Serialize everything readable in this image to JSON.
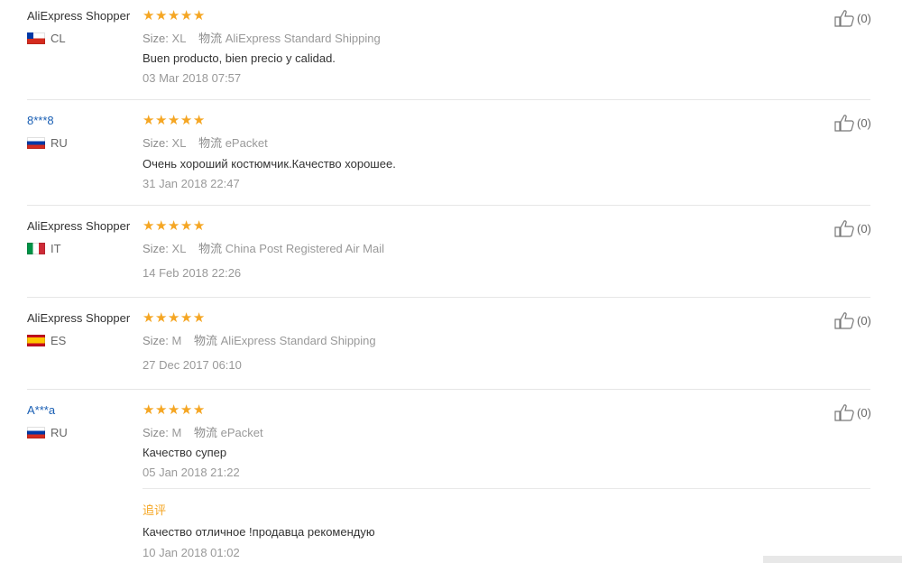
{
  "labels": {
    "size": "Size:",
    "logistics": "物流"
  },
  "reviews": [
    {
      "user": "AliExpress Shopper",
      "country": "CL",
      "size": "XL",
      "shipping": "AliExpress Standard Shipping",
      "comment": "Buen producto, bien precio y calidad.",
      "date": "03 Mar 2018 07:57",
      "helpful": "(0)",
      "rating": 5
    },
    {
      "user": "8***8",
      "country": "RU",
      "size": "XL",
      "shipping": "ePacket",
      "comment": "Очень хороший костюмчик.Качество хорошее.",
      "date": "31 Jan 2018 22:47",
      "helpful": "(0)",
      "rating": 5
    },
    {
      "user": "AliExpress Shopper",
      "country": "IT",
      "size": "XL",
      "shipping": "China Post Registered Air Mail",
      "comment": "",
      "date": "14 Feb 2018 22:26",
      "helpful": "(0)",
      "rating": 5
    },
    {
      "user": "AliExpress Shopper",
      "country": "ES",
      "size": "M",
      "shipping": "AliExpress Standard Shipping",
      "comment": "",
      "date": "27 Dec 2017 06:10",
      "helpful": "(0)",
      "rating": 5
    },
    {
      "user": "A***a",
      "country": "RU",
      "size": "M",
      "shipping": "ePacket",
      "comment": "Качество супер",
      "date": "05 Jan 2018 21:22",
      "helpful": "(0)",
      "rating": 5,
      "followup": {
        "label": "追评",
        "comment": "Качество отличное !продавца рекомендую",
        "date": "10 Jan 2018 01:02"
      }
    }
  ],
  "colors": {
    "star": "#f5a623",
    "link": "#1a5fb4",
    "muted": "#999999"
  },
  "icons": {
    "star": "star-icon",
    "helpful": "thumbs-up-icon"
  }
}
